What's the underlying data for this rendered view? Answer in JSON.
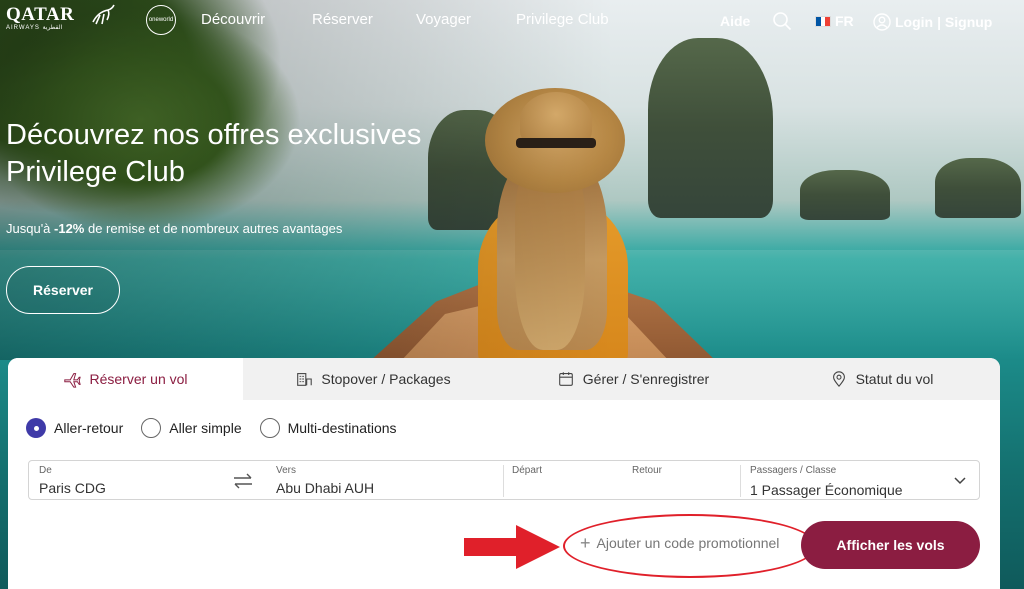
{
  "header": {
    "brand": "QATAR",
    "brand_sub": "AIRWAYS القطرية",
    "alliance": "oneworld",
    "nav": [
      "Découvrir",
      "Réserver",
      "Voyager",
      "Privilege Club"
    ],
    "help": "Aide",
    "language": "FR",
    "login": "Login",
    "signup": "| Signup"
  },
  "hero": {
    "title": "Découvrez nos offres exclusives Privilege Club",
    "subtitle_prefix": "Jusqu'à ",
    "subtitle_highlight": "-12%",
    "subtitle_suffix": " de remise et de nombreux autres avantages",
    "cta": "Réserver"
  },
  "booking": {
    "tabs": [
      {
        "label": "Réserver un vol",
        "icon": "plane-icon",
        "active": true
      },
      {
        "label": "Stopover / Packages",
        "icon": "hotel-icon",
        "active": false
      },
      {
        "label": "Gérer / S'enregistrer",
        "icon": "calendar-icon",
        "active": false
      },
      {
        "label": "Statut du vol",
        "icon": "location-pin-icon",
        "active": false
      }
    ],
    "trip_types": [
      {
        "label": "Aller-retour",
        "selected": true
      },
      {
        "label": "Aller simple",
        "selected": false
      },
      {
        "label": "Multi-destinations",
        "selected": false
      }
    ],
    "from": {
      "label": "De",
      "value": "Paris CDG"
    },
    "to": {
      "label": "Vers",
      "value": "Abu Dhabi AUH"
    },
    "depart": {
      "label": "Départ",
      "value": ""
    },
    "return": {
      "label": "Retour",
      "value": ""
    },
    "passengers": {
      "label": "Passagers / Classe",
      "value": "1 Passager Économique"
    },
    "promo_label": "Ajouter un code promotionnel",
    "search_button": "Afficher les vols"
  },
  "colors": {
    "accent": "#8b1d41",
    "radio_selected": "#3f3aa8",
    "annotation": "#e0202a"
  }
}
